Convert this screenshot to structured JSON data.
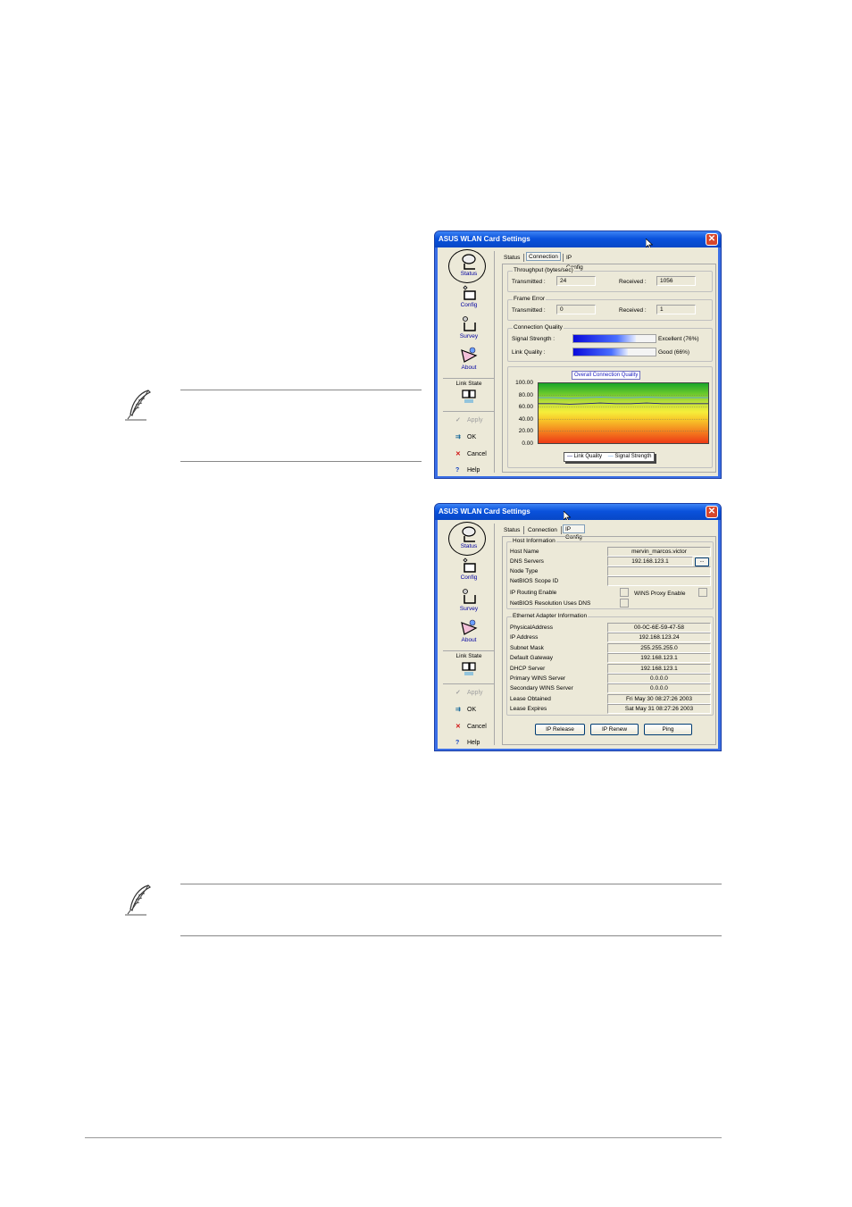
{
  "window1": {
    "title": "ASUS WLAN Card Settings",
    "close": "✕",
    "sidebar": {
      "status": "Status",
      "config": "Config",
      "survey": "Survey",
      "about": "About",
      "link_state": "Link State",
      "apply": "Apply",
      "ok": "OK",
      "cancel": "Cancel",
      "help": "Help"
    },
    "tabs": [
      "Status",
      "Connection",
      "IP Config"
    ],
    "selected_tab": "Connection",
    "throughput": {
      "title": "Throughput (bytes/sec)",
      "transmitted_label": "Transmitted :",
      "transmitted_value": "24",
      "received_label": "Received :",
      "received_value": "1056"
    },
    "frame_error": {
      "title": "Frame Error",
      "transmitted_label": "Transmitted :",
      "transmitted_value": "0",
      "received_label": "Received :",
      "received_value": "1"
    },
    "connection_quality": {
      "title": "Connection Quality",
      "signal_label": "Signal Strength :",
      "signal_text": "Excellent (76%)",
      "signal_fraction": 0.76,
      "link_label": "Link Quality :",
      "link_text": "Good (66%)",
      "link_fraction": 0.66
    }
  },
  "chart_data": {
    "type": "line",
    "title": "Overall Connection Quality",
    "ylim": [
      0,
      100
    ],
    "yticks": [
      "100.00",
      "80.00",
      "60.00",
      "40.00",
      "20.00",
      "0.00"
    ],
    "series": [
      {
        "name": "Link Quality",
        "values": [
          66,
          66,
          65,
          66,
          67,
          66,
          66,
          67,
          66,
          66,
          66,
          66
        ]
      },
      {
        "name": "Signal Strength",
        "values": [
          76,
          76,
          75,
          76,
          77,
          76,
          76,
          77,
          76,
          76,
          76,
          76
        ]
      }
    ],
    "colors": {
      "Link Quality": "#1a1a7a",
      "Signal Strength": "#5aa0e8"
    },
    "legend": "bottom"
  },
  "window2": {
    "title": "ASUS WLAN Card Settings",
    "close": "✕",
    "tabs": [
      "Status",
      "Connection",
      "IP Config"
    ],
    "selected_tab": "IP Config",
    "host_info": {
      "title": "Host Information",
      "host_name_label": "Host Name",
      "host_name": "mervin_marcos.victor",
      "dns_label": "DNS Servers",
      "dns": "192.168.123.1",
      "dns_more": "...",
      "node_type_label": "Node Type",
      "node_type": "",
      "netbios_scope_label": "NetBIOS Scope ID",
      "netbios_scope": "",
      "ip_routing_label": "IP Routing Enable",
      "wins_proxy_label": "WINS Proxy Enable",
      "netbios_dns_label": "NetBIOS Resolution Uses DNS"
    },
    "adapter": {
      "title": "Ethernet Adapter Information",
      "rows": [
        {
          "label": "PhysicalAddress",
          "value": "00-0C-6E-59-47-58"
        },
        {
          "label": "IP Address",
          "value": "192.168.123.24"
        },
        {
          "label": "Subnet Mask",
          "value": "255.255.255.0"
        },
        {
          "label": "Default Gateway",
          "value": "192.168.123.1"
        },
        {
          "label": "DHCP Server",
          "value": "192.168.123.1"
        },
        {
          "label": "Primary WINS Server",
          "value": "0.0.0.0"
        },
        {
          "label": "Secondary WINS Server",
          "value": "0.0.0.0"
        },
        {
          "label": "Lease Obtained",
          "value": "Fri May 30 08:27:26 2003"
        },
        {
          "label": "Lease Expires",
          "value": "Sat May 31 08:27:26 2003"
        }
      ]
    },
    "buttons": {
      "release": "IP Release",
      "renew": "IP Renew",
      "ping": "Ping"
    }
  }
}
